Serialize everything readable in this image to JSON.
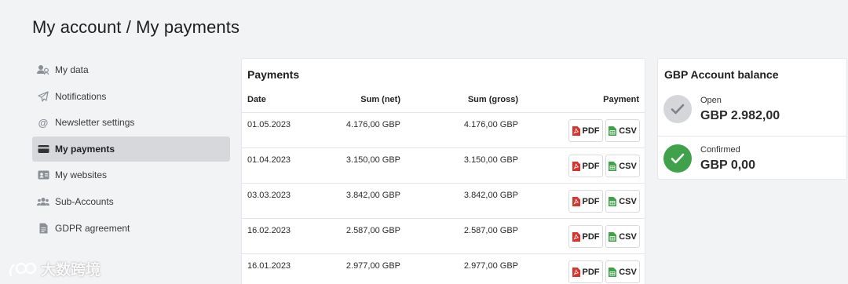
{
  "header": {
    "title": "My account / My payments"
  },
  "sidebar": {
    "items": [
      {
        "label": "My data",
        "icon": "user-group-icon"
      },
      {
        "label": "Notifications",
        "icon": "paper-plane-icon"
      },
      {
        "label": "Newsletter settings",
        "icon": "at-icon"
      },
      {
        "label": "My payments",
        "icon": "credit-card-icon",
        "active": true
      },
      {
        "label": "My websites",
        "icon": "id-card-icon"
      },
      {
        "label": "Sub-Accounts",
        "icon": "users-icon"
      },
      {
        "label": "GDPR agreement",
        "icon": "document-icon"
      }
    ]
  },
  "payments": {
    "title": "Payments",
    "columns": {
      "date": "Date",
      "net": "Sum (net)",
      "gross": "Sum (gross)",
      "payment": "Payment"
    },
    "pdf_label": "PDF",
    "csv_label": "CSV",
    "rows": [
      {
        "date": "01.05.2023",
        "net": "4.176,00 GBP",
        "gross": "4.176,00 GBP"
      },
      {
        "date": "01.04.2023",
        "net": "3.150,00 GBP",
        "gross": "3.150,00 GBP"
      },
      {
        "date": "03.03.2023",
        "net": "3.842,00 GBP",
        "gross": "3.842,00 GBP"
      },
      {
        "date": "16.02.2023",
        "net": "2.587,00 GBP",
        "gross": "2.587,00 GBP"
      },
      {
        "date": "16.01.2023",
        "net": "2.977,00 GBP",
        "gross": "2.977,00 GBP"
      }
    ]
  },
  "balance": {
    "title": "GBP Account balance",
    "open": {
      "label": "Open",
      "value": "GBP 2.982,00"
    },
    "confirmed": {
      "label": "Confirmed",
      "value": "GBP 0,00"
    }
  },
  "watermark": {
    "text": "大数跨境"
  },
  "colors": {
    "active_bg": "#d6d8db",
    "confirmed": "#3fa14a",
    "pdf_red": "#d9332b",
    "csv_green": "#3fa14a",
    "open_grey": "#d4d6da"
  }
}
